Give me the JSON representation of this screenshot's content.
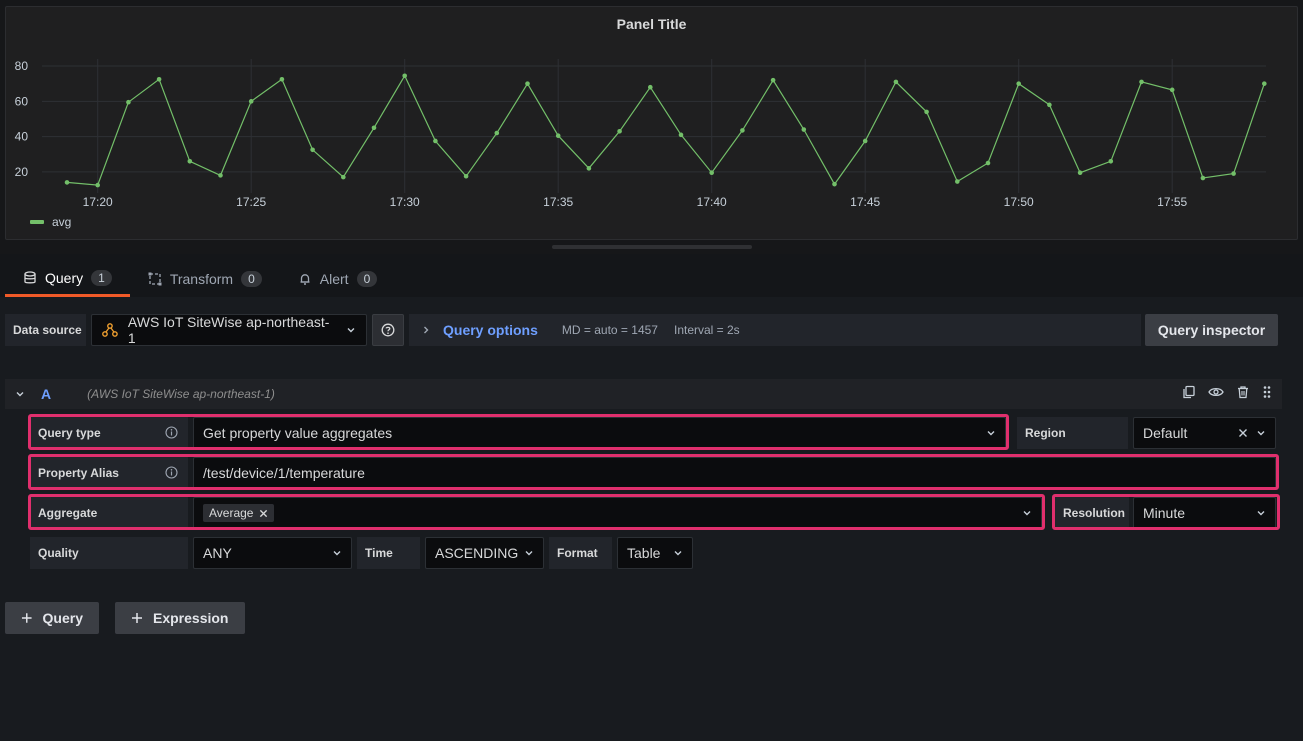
{
  "panel": {
    "title": "Panel Title",
    "legend": [
      {
        "name": "avg",
        "color": "#73bf69"
      }
    ]
  },
  "chart_data": {
    "type": "line",
    "title": "Panel Title",
    "xlabel": "",
    "ylabel": "",
    "x_tick_labels": [
      "17:20",
      "17:25",
      "17:30",
      "17:35",
      "17:40",
      "17:45",
      "17:50",
      "17:55"
    ],
    "y_ticks": [
      20,
      40,
      60,
      80
    ],
    "ylim": [
      8,
      84
    ],
    "grid": true,
    "legend_placement": "bottom-left",
    "series": [
      {
        "name": "avg",
        "color": "#73bf69",
        "x_minutes_since_1719": [
          0,
          1,
          2,
          3,
          4,
          5,
          6,
          7,
          8,
          9,
          10,
          11,
          12,
          13,
          14,
          15,
          16,
          17,
          18,
          19,
          20,
          21,
          22,
          23,
          24,
          25,
          26,
          27,
          28,
          29,
          30,
          31,
          32,
          33,
          34,
          35,
          36,
          37,
          38,
          39
        ],
        "values": [
          14,
          12.5,
          59.5,
          72.5,
          26,
          18,
          60,
          72.5,
          32.5,
          17,
          45,
          74.5,
          37.5,
          17.5,
          42,
          70,
          40.5,
          22,
          43,
          68,
          41,
          19.5,
          43.5,
          72,
          44,
          13,
          37.5,
          71,
          54,
          14.5,
          25,
          70,
          58,
          19.5,
          26,
          71,
          66.5,
          16.5,
          19,
          70
        ]
      }
    ]
  },
  "tabs": [
    {
      "label": "Query",
      "count": "1",
      "icon": "database-icon"
    },
    {
      "label": "Transform",
      "count": "0",
      "icon": "transform-icon"
    },
    {
      "label": "Alert",
      "count": "0",
      "icon": "bell-icon"
    }
  ],
  "datasource": {
    "label": "Data source",
    "name": "AWS IoT SiteWise ap-northeast-1",
    "query_options_label": "Query options",
    "md": "MD = auto = 1457",
    "interval": "Interval = 2s",
    "inspector_label": "Query inspector"
  },
  "query": {
    "ref_id": "A",
    "datasource_name": "(AWS IoT SiteWise ap-northeast-1)",
    "query_type_label": "Query type",
    "query_type_value": "Get property value aggregates",
    "region_label": "Region",
    "region_value": "Default",
    "property_alias_label": "Property Alias",
    "property_alias_value": "/test/device/1/temperature",
    "aggregate_label": "Aggregate",
    "aggregate_tag": "Average",
    "resolution_label": "Resolution",
    "resolution_value": "Minute",
    "quality_label": "Quality",
    "quality_value": "ANY",
    "time_label": "Time",
    "time_value": "ASCENDING",
    "format_label": "Format",
    "format_value": "Table"
  },
  "buttons": {
    "add_query": "Query",
    "add_expression": "Expression"
  },
  "colors": {
    "accent_tab": "#f05a28",
    "highlight": "#e02f6d",
    "link_blue": "#6e9fff",
    "series": "#73bf69"
  }
}
